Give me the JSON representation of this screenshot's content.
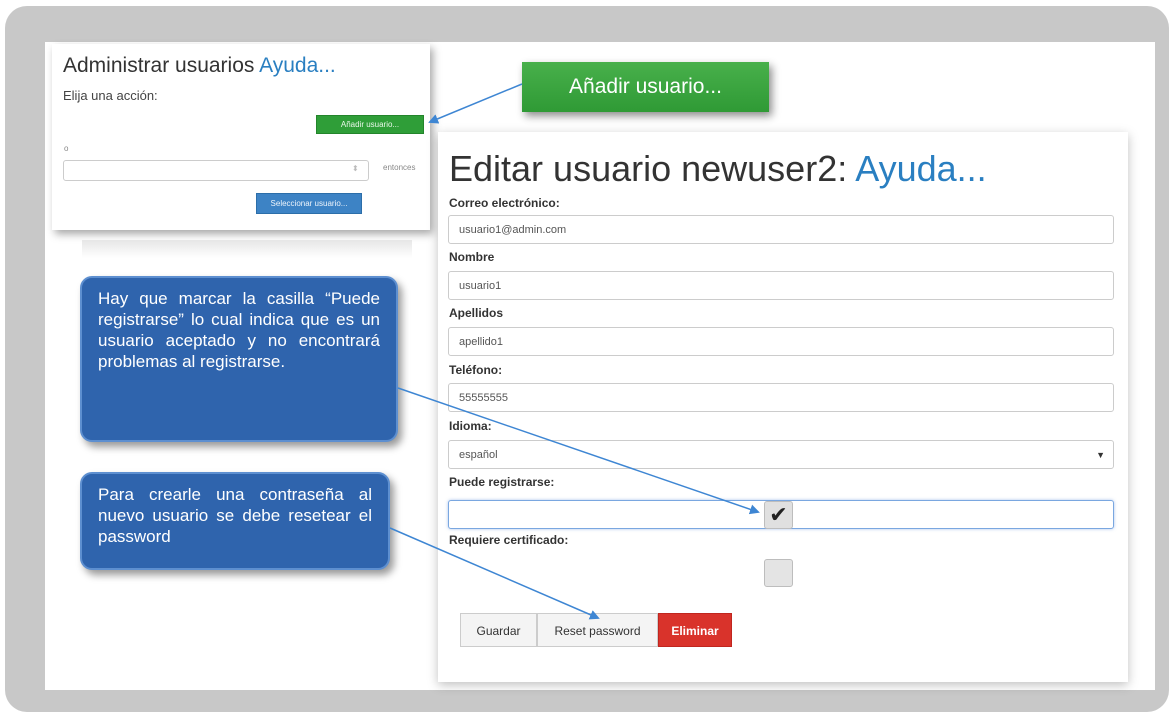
{
  "left_panel": {
    "title": "Administrar usuarios",
    "title_link": "Ayuda...",
    "choose_action": "Elija una acción:",
    "add_user_small": "Añadir usuario...",
    "o_label": "o",
    "then_label": "entonces",
    "select_user_button": "Seleccionar usuario..."
  },
  "add_user_big": "Añadir usuario...",
  "form": {
    "title": "Editar usuario newuser2:",
    "title_link": "Ayuda...",
    "email_label": "Correo electrónico:",
    "email_value": "usuario1@admin.com",
    "name_label": "Nombre",
    "name_value": "usuario1",
    "surname_label": "Apellidos",
    "surname_value": "apellido1",
    "phone_label": "Teléfono:",
    "phone_value": "55555555",
    "language_label": "Idioma:",
    "language_value": "español",
    "can_register_label": "Puede registrarse:",
    "can_register_checked": true,
    "requires_cert_label": "Requiere certificado:",
    "requires_cert_checked": false,
    "save_button": "Guardar",
    "reset_button": "Reset password",
    "delete_button": "Eliminar"
  },
  "callouts": {
    "register_note": "Hay que marcar la casilla “Puede registrarse” lo cual indica que es un usuario aceptado y no encontrará problemas al registrarse.",
    "password_note": "Para crearle una contraseña al nuevo usuario se debe resetear el password"
  },
  "colors": {
    "green": "#2f9e38",
    "blue_button": "#3d83c5",
    "callout_blue": "#2f64ad",
    "delete_red": "#d9332b",
    "link_blue": "#2a7fc1",
    "arrow": "#3e86d3"
  }
}
